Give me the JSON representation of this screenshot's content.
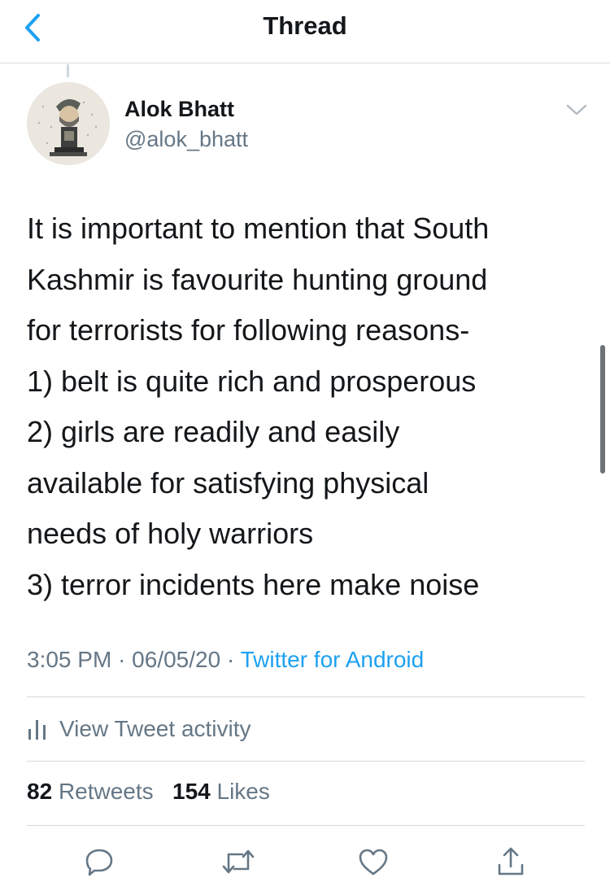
{
  "header": {
    "title": "Thread"
  },
  "tweet": {
    "author_name": "Alok Bhatt",
    "author_handle": "@alok_bhatt",
    "text_lines": [
      "It is important to mention that South",
      "Kashmir is favourite hunting ground",
      "for terrorists for following reasons-",
      "1) belt is quite rich and prosperous",
      "2) girls are readily and easily",
      "available for satisfying physical",
      "needs of holy warriors",
      "3) terror incidents here make noise"
    ],
    "time": "3:05 PM",
    "date": "06/05/20",
    "source": "Twitter for Android",
    "separator": "·"
  },
  "activity": {
    "label": "View Tweet activity"
  },
  "stats": {
    "retweets_count": "82",
    "retweets_label": "Retweets",
    "likes_count": "154",
    "likes_label": "Likes"
  },
  "icons": {
    "back": "chevron-left-icon",
    "caret": "chevron-down-icon",
    "activity": "bar-chart-icon",
    "reply": "reply-icon",
    "retweet": "retweet-icon",
    "like": "heart-icon",
    "share": "share-icon"
  },
  "colors": {
    "accent": "#1da1f2",
    "text_primary": "#14171a",
    "text_secondary": "#657786",
    "divider": "#d6dbdf"
  }
}
